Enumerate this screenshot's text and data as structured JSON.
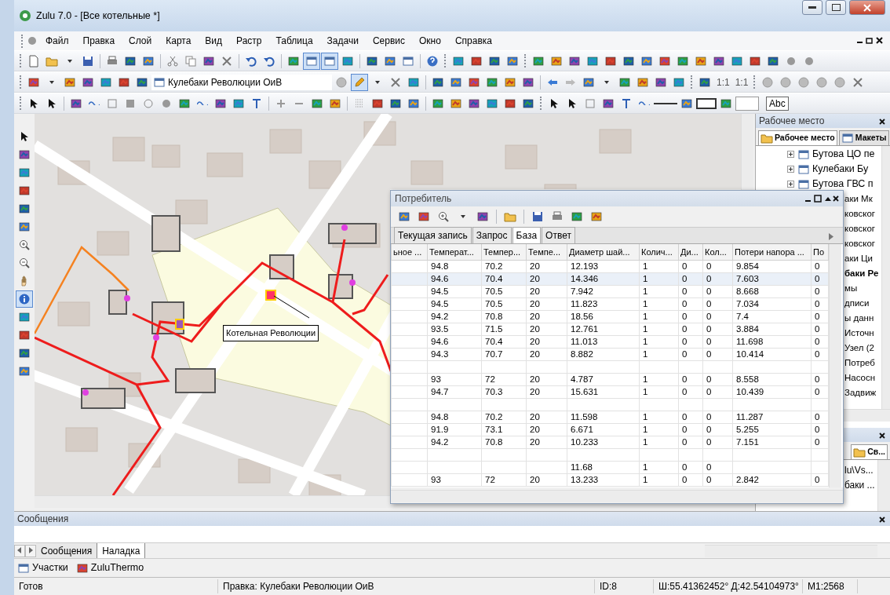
{
  "window": {
    "title": "Zulu 7.0 - [Все котельные *]"
  },
  "menu": [
    "Файл",
    "Правка",
    "Слой",
    "Карта",
    "Вид",
    "Растр",
    "Таблица",
    "Задачи",
    "Сервис",
    "Окно",
    "Справка"
  ],
  "layer_combo": {
    "value": "Кулебаки Революции ОиВ"
  },
  "toolbar_texts": {
    "scale_a": "1:1",
    "scale_b": "1:1",
    "text_sample": "Abc"
  },
  "vertical_tools": [
    {
      "selected": false
    },
    {
      "selected": false
    },
    {
      "selected": false
    },
    {
      "selected": false
    },
    {
      "selected": false
    },
    {
      "selected": false
    },
    {
      "selected": false
    },
    {
      "selected": false
    },
    {
      "selected": false
    },
    {
      "selected": true
    },
    {
      "selected": false
    },
    {
      "selected": false
    },
    {
      "selected": false
    },
    {
      "selected": false
    }
  ],
  "map": {
    "callout": "Котельная Революции"
  },
  "consumer_window": {
    "title": "Потребитель",
    "tabs": [
      {
        "label": "Текущая запись",
        "selected": false
      },
      {
        "label": "Запрос",
        "selected": false
      },
      {
        "label": "База",
        "selected": true
      },
      {
        "label": "Ответ",
        "selected": false
      }
    ],
    "columns": [
      "ьное ...",
      "Температ...",
      "Темпер...",
      "Темпе...",
      "Диаметр шай...",
      "Колич...",
      "Ди...",
      "Кол...",
      "Потери напора ...",
      "По"
    ],
    "rows": [
      {
        "selected": false,
        "cells": [
          null,
          "94.8",
          "70.2",
          "20",
          "12.193",
          "1",
          "0",
          "0",
          "9.854",
          "0"
        ]
      },
      {
        "selected": true,
        "cells": [
          null,
          "94.6",
          "70.4",
          "20",
          "14.346",
          "1",
          "0",
          "0",
          "7.603",
          "0"
        ]
      },
      {
        "selected": false,
        "cells": [
          null,
          "94.5",
          "70.5",
          "20",
          "7.942",
          "1",
          "0",
          "0",
          "8.668",
          "0"
        ]
      },
      {
        "selected": false,
        "cells": [
          null,
          "94.5",
          "70.5",
          "20",
          "11.823",
          "1",
          "0",
          "0",
          "7.034",
          "0"
        ]
      },
      {
        "selected": false,
        "cells": [
          null,
          "94.2",
          "70.8",
          "20",
          "18.56",
          "1",
          "0",
          "0",
          "7.4",
          "0"
        ]
      },
      {
        "selected": false,
        "cells": [
          null,
          "93.5",
          "71.5",
          "20",
          "12.761",
          "1",
          "0",
          "0",
          "3.884",
          "0"
        ]
      },
      {
        "selected": false,
        "cells": [
          null,
          "94.6",
          "70.4",
          "20",
          "11.013",
          "1",
          "0",
          "0",
          "11.698",
          "0"
        ]
      },
      {
        "selected": false,
        "cells": [
          null,
          "94.3",
          "70.7",
          "20",
          "8.882",
          "1",
          "0",
          "0",
          "10.414",
          "0"
        ]
      },
      {
        "selected": false,
        "cells": [
          null,
          null,
          null,
          null,
          null,
          null,
          null,
          null,
          null,
          null
        ]
      },
      {
        "selected": false,
        "cells": [
          null,
          "93",
          "72",
          "20",
          "4.787",
          "1",
          "0",
          "0",
          "8.558",
          "0"
        ]
      },
      {
        "selected": false,
        "cells": [
          null,
          "94.7",
          "70.3",
          "20",
          "15.631",
          "1",
          "0",
          "0",
          "10.439",
          "0"
        ]
      },
      {
        "selected": false,
        "cells": [
          null,
          null,
          null,
          null,
          null,
          null,
          null,
          null,
          null,
          null
        ]
      },
      {
        "selected": false,
        "cells": [
          null,
          "94.8",
          "70.2",
          "20",
          "11.598",
          "1",
          "0",
          "0",
          "11.287",
          "0"
        ]
      },
      {
        "selected": false,
        "cells": [
          null,
          "91.9",
          "73.1",
          "20",
          "6.671",
          "1",
          "0",
          "0",
          "5.255",
          "0"
        ]
      },
      {
        "selected": false,
        "cells": [
          null,
          "94.2",
          "70.8",
          "20",
          "10.233",
          "1",
          "0",
          "0",
          "7.151",
          "0"
        ]
      },
      {
        "selected": false,
        "cells": [
          null,
          null,
          null,
          null,
          null,
          null,
          null,
          null,
          null,
          null
        ]
      },
      {
        "selected": false,
        "cells": [
          null,
          null,
          null,
          null,
          "11.68",
          "1",
          "0",
          "0",
          null,
          null
        ]
      },
      {
        "selected": false,
        "cells": [
          null,
          "93",
          "72",
          "20",
          "13.233",
          "1",
          "0",
          "0",
          "2.842",
          "0"
        ]
      }
    ]
  },
  "workspace_panel": {
    "title": "Рабочее место",
    "tabs": [
      {
        "label": "Рабочее место",
        "selected": true
      },
      {
        "label": "Макеты",
        "selected": false
      }
    ],
    "tree": [
      {
        "label": "Бутова ЦО пе",
        "kind": "layer",
        "bold": false
      },
      {
        "label": "Кулебаки Бу",
        "kind": "layer",
        "bold": false
      },
      {
        "label": "Бутова ГВС п",
        "kind": "layer",
        "bold": false
      },
      {
        "label": "аки Мк",
        "kind": "clipped",
        "bold": false
      },
      {
        "label": "ковског",
        "kind": "clipped",
        "bold": false
      },
      {
        "label": "ковског",
        "kind": "clipped",
        "bold": false
      },
      {
        "label": "ковског",
        "kind": "clipped",
        "bold": false
      },
      {
        "label": "аки Ци",
        "kind": "clipped",
        "bold": false
      },
      {
        "label": "баки Ре",
        "kind": "clipped",
        "bold": true
      },
      {
        "label": "мы",
        "kind": "clipped",
        "bold": false
      },
      {
        "label": "дписи",
        "kind": "clipped",
        "bold": false
      },
      {
        "label": "ы данн",
        "kind": "clipped",
        "bold": false
      },
      {
        "label": "Источн",
        "kind": "clipped",
        "bold": false
      },
      {
        "label": "Узел (2",
        "kind": "clipped",
        "bold": false
      },
      {
        "label": "Потреб",
        "kind": "clipped",
        "bold": false
      },
      {
        "label": "Насосн",
        "kind": "clipped",
        "bold": false
      },
      {
        "label": "Задвиж",
        "kind": "clipped",
        "bold": false
      }
    ]
  },
  "properties_panel": {
    "tab": "Св...",
    "rows": [
      "lu\\Vs...",
      "баки ..."
    ]
  },
  "messages_panel": {
    "title": "Сообщения",
    "tabs": [
      {
        "label": "Сообщения",
        "selected": false
      },
      {
        "label": "Наладка",
        "selected": true
      }
    ]
  },
  "taskbar": [
    "Участки",
    "ZuluThermo"
  ],
  "status_bar": [
    "Готов",
    "Правка: Кулебаки Революции ОиВ",
    "ID:8",
    "Ш:55.41362452°  Д:42.54104973°",
    "M1:2568"
  ]
}
